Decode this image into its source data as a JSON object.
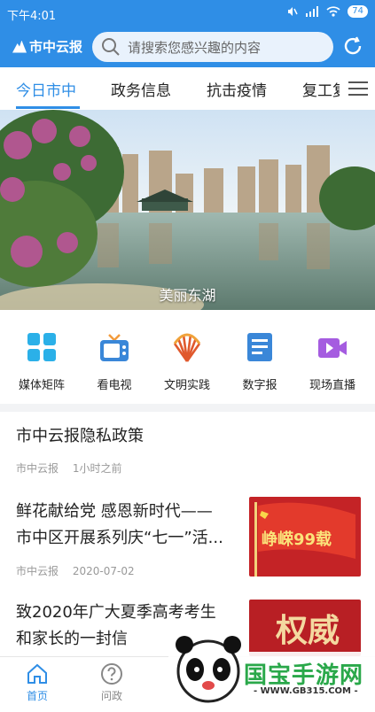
{
  "status_bar": {
    "time": "下午4:01",
    "battery": "74"
  },
  "header": {
    "logo_text": "市中云报",
    "search_placeholder": "请搜索您感兴趣的内容"
  },
  "tabs": [
    {
      "label": "今日市中",
      "active": true
    },
    {
      "label": "政务信息",
      "active": false
    },
    {
      "label": "抗击疫情",
      "active": false
    },
    {
      "label": "复工复",
      "active": false
    }
  ],
  "banner": {
    "caption": "美丽东湖"
  },
  "shortcuts": [
    {
      "label": "媒体矩阵",
      "icon": "grid-icon"
    },
    {
      "label": "看电视",
      "icon": "tv-icon"
    },
    {
      "label": "文明实践",
      "icon": "fan-icon"
    },
    {
      "label": "数字报",
      "icon": "newspaper-icon"
    },
    {
      "label": "现场直播",
      "icon": "video-icon"
    }
  ],
  "news": [
    {
      "title": "市中云报隐私政策",
      "source": "市中云报",
      "time": "1小时之前"
    },
    {
      "title_line1": "鲜花献给党 感恩新时代——",
      "title_line2": "市中区开展系列庆“七一”活...",
      "source": "市中云报",
      "time": "2020-07-02",
      "thumb_text": "峥嵘99载"
    },
    {
      "title_line1": "致2020年广大夏季高考考生",
      "title_line2": "和家长的一封信",
      "thumb_text": "权威"
    }
  ],
  "bottom_nav": [
    {
      "label": "首页",
      "active": true
    },
    {
      "label": "问政",
      "active": false
    }
  ],
  "watermark": {
    "text": "国宝手游网",
    "url": "- WWW.GB315.COM -"
  },
  "colors": {
    "brand": "#2f8ee6",
    "tab_active": "#2f8ee6"
  }
}
